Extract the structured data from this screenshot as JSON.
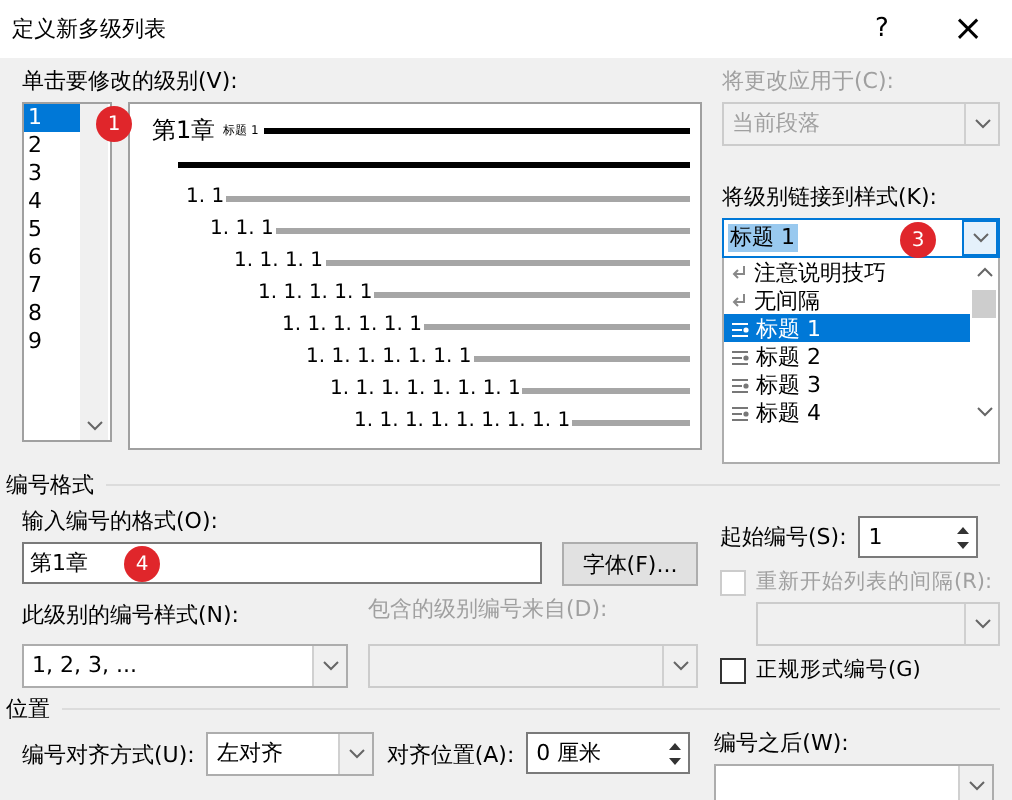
{
  "window": {
    "title": "定义新多级列表",
    "help": "?",
    "close": "×"
  },
  "level_list": {
    "label": "单击要修改的级别(V):",
    "badge": "1",
    "items": [
      {
        "label": "1",
        "selected": true
      },
      {
        "label": "2",
        "selected": false
      },
      {
        "label": "3",
        "selected": false
      },
      {
        "label": "4",
        "selected": false
      },
      {
        "label": "5",
        "selected": false
      },
      {
        "label": "6",
        "selected": false
      },
      {
        "label": "7",
        "selected": false
      },
      {
        "label": "8",
        "selected": false
      },
      {
        "label": "9",
        "selected": false
      }
    ]
  },
  "preview": {
    "heading_number": "第1章",
    "heading_style": "标题 1",
    "rows": [
      "1. 1",
      "1. 1. 1",
      "1. 1. 1. 1",
      "1. 1. 1. 1. 1",
      "1. 1. 1. 1. 1. 1",
      "1. 1. 1. 1. 1. 1. 1",
      "1. 1. 1. 1. 1. 1. 1. 1",
      "1. 1. 1. 1. 1. 1. 1. 1. 1"
    ]
  },
  "apply_to": {
    "label": "将更改应用于(C):",
    "value": "当前段落",
    "disabled": true
  },
  "link_style": {
    "label": "将级别链接到样式(K):",
    "value": "标题 1",
    "badge": "3",
    "options": [
      {
        "label": "注意说明技巧",
        "kind": "paragraph",
        "selected": false
      },
      {
        "label": "无间隔",
        "kind": "paragraph",
        "selected": false
      },
      {
        "label": "标题 1",
        "kind": "linked",
        "selected": true
      },
      {
        "label": "标题 2",
        "kind": "linked",
        "selected": false
      },
      {
        "label": "标题 3",
        "kind": "linked",
        "selected": false
      },
      {
        "label": "标题 4",
        "kind": "linked",
        "selected": false
      }
    ]
  },
  "number_format": {
    "title": "编号格式",
    "format_label": "输入编号的格式(O):",
    "format_value": "第1章",
    "badge": "4",
    "font_button": "字体(F)...",
    "start_label": "起始编号(S):",
    "start_value": "1",
    "restart": {
      "label": "重新开始列表的间隔(R):",
      "checked": false,
      "disabled": true
    },
    "style_label": "此级别的编号样式(N):",
    "style_value": "1, 2, 3, ...",
    "include_label": "包含的级别编号来自(D):",
    "include_disabled": true,
    "legal": {
      "label": "正规形式编号(G)",
      "checked": false
    }
  },
  "position": {
    "title": "位置",
    "align_label": "编号对齐方式(U):",
    "align_value": "左对齐",
    "at_label": "对齐位置(A):",
    "at_value": "0 厘米",
    "after_label": "编号之后(W):"
  }
}
